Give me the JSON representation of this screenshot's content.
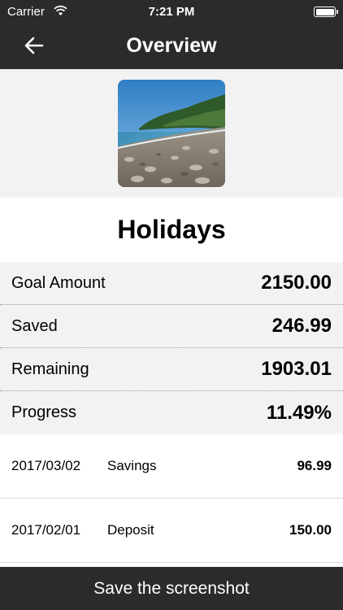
{
  "status_bar": {
    "carrier": "Carrier",
    "time": "7:21 PM"
  },
  "nav": {
    "title": "Overview",
    "back_icon": "arrow-left-icon"
  },
  "goal": {
    "name": "Holidays",
    "image": "beach-photo"
  },
  "stats": [
    {
      "label": "Goal Amount",
      "value": "2150.00"
    },
    {
      "label": "Saved",
      "value": "246.99"
    },
    {
      "label": "Remaining",
      "value": "1903.01"
    },
    {
      "label": "Progress",
      "value": "11.49%"
    }
  ],
  "transactions": [
    {
      "date": "2017/03/02",
      "type": "Savings",
      "amount": "96.99"
    },
    {
      "date": "2017/02/01",
      "type": "Deposit",
      "amount": "150.00"
    }
  ],
  "footer": {
    "save_label": "Save the screenshot"
  },
  "colors": {
    "bar": "#2b2b2b",
    "band": "#f2f2f2"
  }
}
